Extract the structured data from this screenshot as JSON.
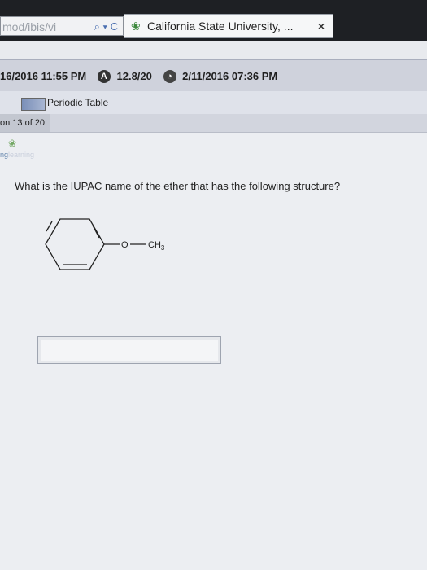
{
  "browser": {
    "url_text": "mod/ibis/vi",
    "url_icons": "⌕ ▾ C",
    "tab_title": "California State University, ...",
    "tab_close": "×"
  },
  "assignment": {
    "date_text": "16/2016 11:55 PM",
    "score_badge": "A",
    "score_text": "12.8/20",
    "due_badge": "◔",
    "due_text": "2/11/2016 07:36 PM"
  },
  "toolbar": {
    "periodic_table_label": "Periodic Table"
  },
  "question_nav": {
    "counter": "on 13 of 20"
  },
  "branding": {
    "prefix": "ng",
    "suffix": "learning"
  },
  "question": {
    "prompt": "What is the IUPAC name of the ether that has the following structure?",
    "structure_oxygen": "O",
    "structure_methyl": "CH",
    "structure_methyl_sub": "3"
  }
}
